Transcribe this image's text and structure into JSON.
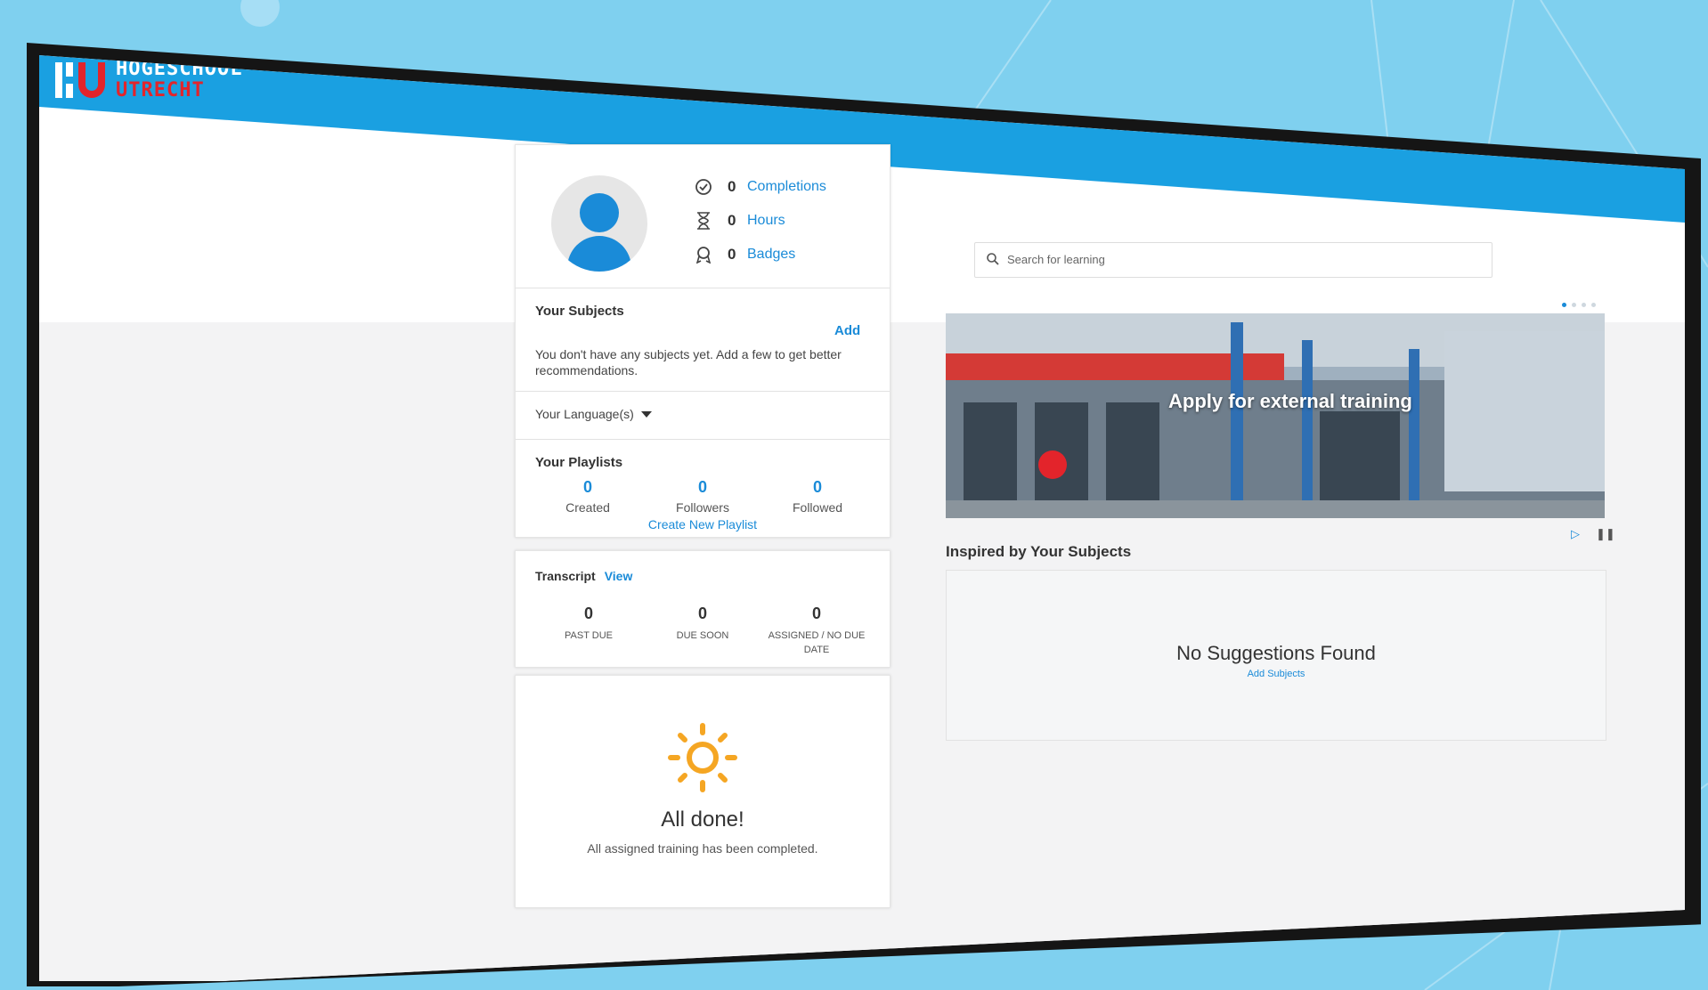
{
  "brand": {
    "line1": "HOGESCHOOL",
    "line2": "UTRECHT"
  },
  "profile": {
    "stats": [
      {
        "icon": "check-circle-icon",
        "value": "0",
        "label": "Completions"
      },
      {
        "icon": "hourglass-icon",
        "value": "0",
        "label": "Hours"
      },
      {
        "icon": "badge-icon",
        "value": "0",
        "label": "Badges"
      }
    ]
  },
  "subjects": {
    "title": "Your Subjects",
    "add_label": "Add",
    "empty_text": "You don't have any subjects yet. Add a few to get better recommendations."
  },
  "languages": {
    "label": "Your Language(s)"
  },
  "playlists": {
    "title": "Your Playlists",
    "columns": [
      {
        "value": "0",
        "label": "Created"
      },
      {
        "value": "0",
        "label": "Followers"
      },
      {
        "value": "0",
        "label": "Followed"
      }
    ],
    "create_label": "Create New Playlist"
  },
  "transcript": {
    "title": "Transcript",
    "view_label": "View",
    "columns": [
      {
        "value": "0",
        "label": "PAST DUE"
      },
      {
        "value": "0",
        "label": "DUE SOON"
      },
      {
        "value": "0",
        "label": "ASSIGNED / NO DUE DATE"
      }
    ]
  },
  "all_done": {
    "icon": "sun-icon",
    "title": "All done!",
    "subtitle": "All assigned training has been completed."
  },
  "search": {
    "placeholder": "Search for learning"
  },
  "banner": {
    "caption": "Apply for external training"
  },
  "inspired": {
    "title": "Inspired by Your Subjects",
    "empty_title": "No Suggestions Found",
    "empty_link": "Add Subjects"
  },
  "colors": {
    "accent": "#1a8bd8",
    "header": "#1aa0e1",
    "brand_red": "#e3242b",
    "sun": "#f5a623"
  }
}
